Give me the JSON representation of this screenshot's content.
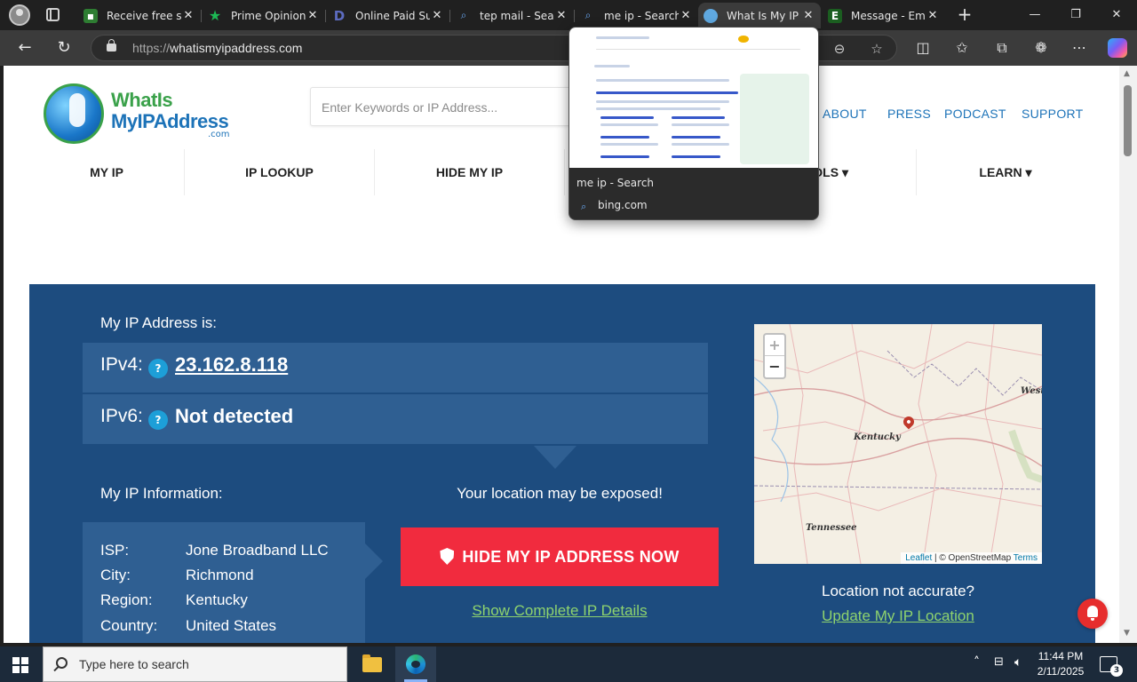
{
  "browser": {
    "tabs": [
      {
        "title": "Receive free sn",
        "favicon": "green-square-icon",
        "color": "#2e7d32"
      },
      {
        "title": "Prime Opinion",
        "favicon": "green-star-icon",
        "color": "#1db954"
      },
      {
        "title": "Online Paid Su",
        "favicon": "blue-d-icon",
        "color": "#3f51b5"
      },
      {
        "title": "tep mail - Sear",
        "favicon": "search-icon",
        "color": "#6aa8f2"
      },
      {
        "title": "me ip - Search",
        "favicon": "search-icon",
        "color": "#6aa8f2"
      },
      {
        "title": "What Is My IP",
        "favicon": "globe-icon",
        "color": "#5fa8e0"
      },
      {
        "title": "Message - Em",
        "favicon": "green-e-icon",
        "color": "#1b5e20"
      }
    ],
    "url_scheme": "https://",
    "url_host": "whatismyipaddress.com",
    "preview": {
      "title": "me ip - Search",
      "site": "bing.com"
    }
  },
  "site": {
    "logo_line1": "WhatIs",
    "logo_line2": "MyIPAddress",
    "logo_com": ".com",
    "search_placeholder": "Enter Keywords or IP Address...",
    "top_links": [
      "ABOUT",
      "PRESS",
      "PODCAST",
      "SUPPORT"
    ],
    "nav": [
      "MY IP",
      "IP LOOKUP",
      "HIDE MY IP",
      "OLS ▾",
      "LEARN ▾"
    ]
  },
  "hero": {
    "my_ip_label": "My IP Address is:",
    "ipv4_label": "IPv4:",
    "ipv4_value": "23.162.8.118",
    "ipv6_label": "IPv6:",
    "ipv6_value": "Not detected",
    "help_glyph": "?",
    "info_label": "My IP Information:",
    "info": [
      {
        "k": "ISP:",
        "v": "Jone Broadband LLC"
      },
      {
        "k": "City:",
        "v": "Richmond"
      },
      {
        "k": "Region:",
        "v": "Kentucky"
      },
      {
        "k": "Country:",
        "v": "United States"
      }
    ],
    "exposed_text": "Your location may be exposed!",
    "hide_button": "HIDE MY IP ADDRESS NOW",
    "details_link": "Show Complete IP Details",
    "location_question": "Location not accurate?",
    "update_link": "Update My IP Location",
    "map": {
      "zoom_in": "+",
      "zoom_out": "−",
      "labels": [
        "Kentucky",
        "Tennessee",
        "West"
      ],
      "attr_leaflet": "Leaflet",
      "attr_osm": "© OpenStreetMap",
      "attr_terms": "Terms"
    }
  },
  "taskbar": {
    "search_placeholder": "Type here to search",
    "time": "11:44 PM",
    "date": "2/11/2025",
    "notifications": "3"
  },
  "colors": {
    "hero_bg": "#1d4c7f",
    "hero_row": "#2f5f92",
    "cta_red": "#f12b3e",
    "link_green": "#8ed36e",
    "brand_blue": "#1d73b8"
  }
}
